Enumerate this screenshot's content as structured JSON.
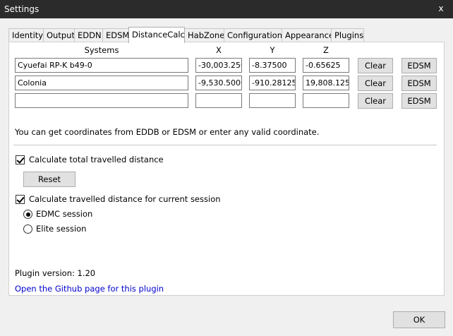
{
  "window": {
    "title": "Settings",
    "close_glyph": "x"
  },
  "tabs": [
    "Identity",
    "Output",
    "EDDN",
    "EDSM",
    "DistanceCalc",
    "HabZone",
    "Configuration",
    "Appearance",
    "Plugins"
  ],
  "active_tab": "DistanceCalc",
  "columns": {
    "systems": "Systems",
    "x": "X",
    "y": "Y",
    "z": "Z"
  },
  "rows": [
    {
      "system": "Cyuefai RP-K b49-0",
      "x": "-30,003.250",
      "y": "-8.37500",
      "z": "-0.65625",
      "clear": "Clear",
      "edsm": "EDSM"
    },
    {
      "system": "Colonia",
      "x": "-9,530.5000",
      "y": "-910.28125",
      "z": "19,808.1250",
      "clear": "Clear",
      "edsm": "EDSM"
    },
    {
      "system": "",
      "x": "",
      "y": "",
      "z": "",
      "clear": "Clear",
      "edsm": "EDSM"
    }
  ],
  "note": "You can get coordinates from EDDB or EDSM or enter any valid coordinate.",
  "total_distance": {
    "label": "Calculate total travelled distance",
    "checked": true,
    "reset": "Reset"
  },
  "session_distance": {
    "label": "Calculate travelled distance for current session",
    "checked": true
  },
  "session_options": [
    {
      "label": "EDMC session",
      "selected": true
    },
    {
      "label": "Elite session",
      "selected": false
    }
  ],
  "plugin_version": "Plugin version: 1.20",
  "github_link": "Open the Github page for this plugin",
  "ok": "OK"
}
